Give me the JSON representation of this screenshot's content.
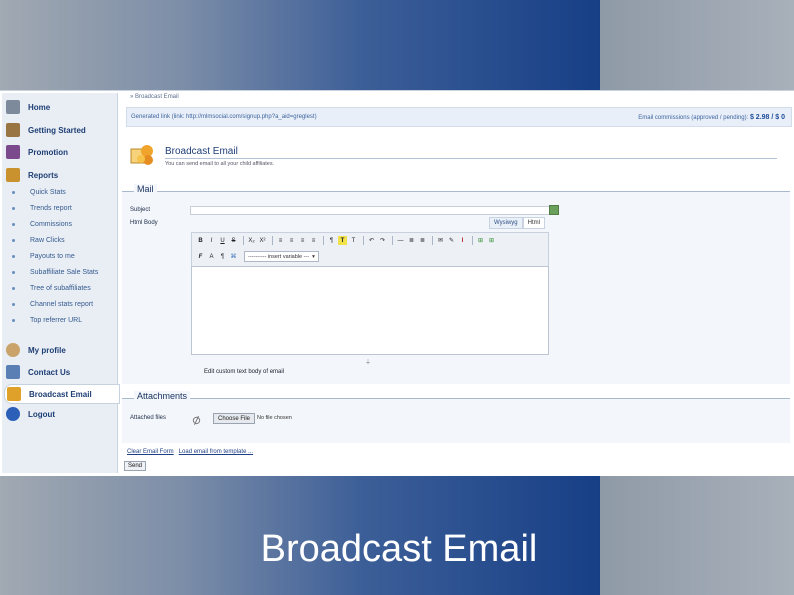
{
  "slide": {
    "caption": "Broadcast Email"
  },
  "sidebar": {
    "items": [
      {
        "label": "Home",
        "icon": "home-icon",
        "color": "#6f7f94"
      },
      {
        "label": "Getting Started",
        "icon": "book-icon",
        "color": "#8a6a3c"
      },
      {
        "label": "Promotion",
        "icon": "promotion-icon",
        "color": "#7b4a8c"
      },
      {
        "label": "Reports",
        "icon": "reports-icon",
        "color": "#c08a2e"
      }
    ],
    "report_links": [
      "Quick Stats",
      "Trends report",
      "Commissions",
      "Raw Clicks",
      "Payouts to me",
      "Subaffiliate Sale Stats",
      "Tree of subaffiliates",
      "Channel stats report",
      "Top referrer URL"
    ],
    "bottom_items": [
      {
        "label": "My profile",
        "icon": "profile-icon",
        "color": "#c9a36a"
      },
      {
        "label": "Contact Us",
        "icon": "contact-icon",
        "color": "#5a7fb5"
      },
      {
        "label": "Broadcast Email",
        "icon": "broadcast-icon",
        "color": "#e0a12b",
        "active": true
      },
      {
        "label": "Logout",
        "icon": "logout-icon",
        "color": "#2b5fb8"
      }
    ]
  },
  "main": {
    "breadcrumb": "» Broadcast Email",
    "info_left": "Generated link (link: http://mlmsocial.com/signup.php?a_aid=greglest)",
    "info_right_label": "Email commissions (approved / pending):",
    "info_right_value": "$ 2.98 / $ 0",
    "page_title": "Broadcast Email",
    "page_subtitle": "You can send email to all your child affiliates.",
    "mail_section": "Mail",
    "subject_label": "Subject",
    "body_label": "Html Body",
    "mode_tabs": [
      "Wysiwyg",
      "Html"
    ],
    "toolbar_row1": [
      "B",
      "I",
      "U",
      "S",
      "X₂",
      "X²",
      "≡",
      "≡",
      "≡",
      "≡",
      "¶",
      "T",
      "T",
      "↶",
      "↷",
      "—",
      "≣",
      "≣",
      "✉",
      "✎",
      "Ι",
      "⊞",
      "⊞"
    ],
    "toolbar_row2": [
      "F",
      "A",
      "¶",
      "⌘"
    ],
    "insert_variable": "---------- insert variable ---",
    "edit_caption": "Edit custom text body of email",
    "attachments_section": "Attachments",
    "attached_label": "Attached files",
    "choose_button": "Choose File",
    "no_file": "No file chosen",
    "clear_link": "Clear Email Form",
    "load_link": "Load email from template ...",
    "send_button": "Send"
  }
}
